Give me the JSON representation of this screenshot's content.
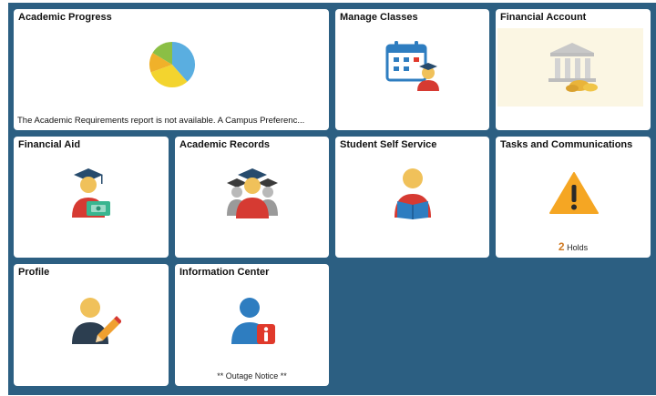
{
  "tiles": {
    "academic_progress": {
      "title": "Academic Progress",
      "notice": "The Academic Requirements report is not available.  A Campus Preferenc..."
    },
    "manage_classes": {
      "title": "Manage Classes"
    },
    "financial_account": {
      "title": "Financial Account"
    },
    "financial_aid": {
      "title": "Financial Aid"
    },
    "academic_records": {
      "title": "Academic Records"
    },
    "student_self_service": {
      "title": "Student Self Service"
    },
    "tasks_and_communications": {
      "title": "Tasks and Communications",
      "holds_count": "2",
      "holds_label": "Holds"
    },
    "profile": {
      "title": "Profile"
    },
    "information_center": {
      "title": "Information Center",
      "footer": "** Outage Notice **"
    }
  },
  "icons": {
    "academic_progress": "pie-chart-icon",
    "manage_classes": "calendar-student-icon",
    "financial_account": "bank-coins-icon",
    "financial_aid": "graduate-money-icon",
    "academic_records": "graduates-group-icon",
    "student_self_service": "student-reading-icon",
    "tasks_and_communications": "warning-triangle-icon",
    "profile": "person-pencil-icon",
    "information_center": "person-info-icon"
  },
  "colors": {
    "background": "#2c5f82",
    "tile": "#ffffff",
    "accent_orange": "#d07a22",
    "warning": "#f5a623"
  }
}
